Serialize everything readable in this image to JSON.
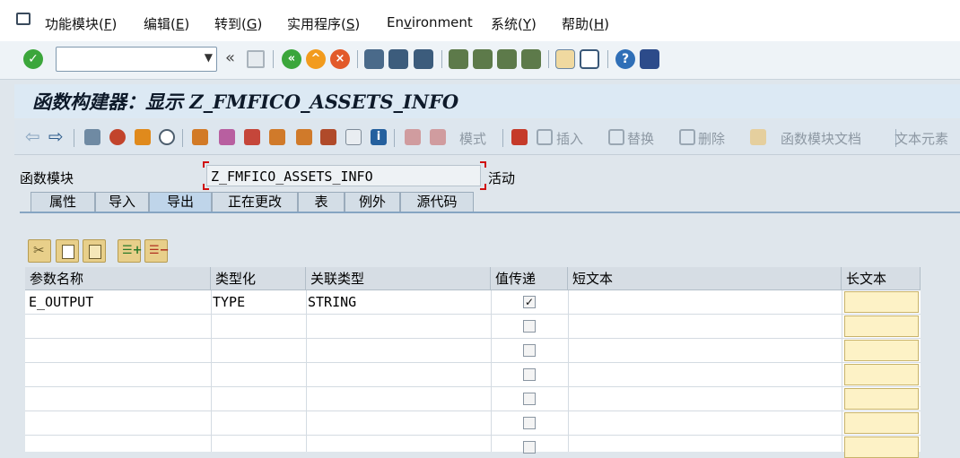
{
  "menu": {
    "items": [
      {
        "label": "功能模块(",
        "key": "F",
        "end": ")"
      },
      {
        "label": "编辑(",
        "key": "E",
        "end": ")"
      },
      {
        "label": "转到(",
        "key": "G",
        "end": ")"
      },
      {
        "label": "实用程序(",
        "key": "S",
        "end": ")"
      },
      {
        "label": "En",
        "key": "v",
        "end": "ironment"
      },
      {
        "label": "系统(",
        "key": "Y",
        "end": ")"
      },
      {
        "label": "帮助(",
        "key": "H",
        "end": ")"
      }
    ]
  },
  "toolbar": {
    "command_value": "",
    "back_chevron": "«"
  },
  "title": "函数构建器：显示 Z_FMFICO_ASSETS_INFO",
  "app_toolbar": {
    "mode_label": "模式",
    "insert_label": "插入",
    "replace_label": "替换",
    "delete_label": "删除",
    "fm_doc_label": "函数模块文档",
    "text_elements_label": "文本元素"
  },
  "function_module": {
    "label": "函数模块",
    "value": "Z_FMFICO_ASSETS_INFO",
    "status": "活动"
  },
  "tabs": [
    "属性",
    "导入",
    "导出",
    "正在更改",
    "表",
    "例外",
    "源代码"
  ],
  "active_tab": "导出",
  "table": {
    "columns": [
      "参数名称",
      "类型化",
      "关联类型",
      "值传递",
      "短文本",
      "长文本"
    ],
    "rows": [
      {
        "name": "E_OUTPUT",
        "typing": "TYPE",
        "assoc_type": "STRING",
        "pass_by_value": true,
        "short_text": ""
      }
    ]
  },
  "colors": {
    "title_bg": "#dce9f4",
    "tab_active": "#bfd5ea",
    "long_text_cell": "#fdf2c6",
    "accent_green": "#3ba63b"
  }
}
